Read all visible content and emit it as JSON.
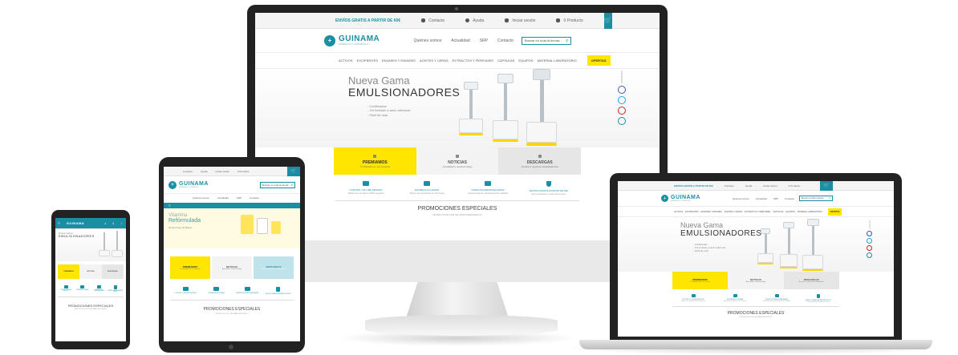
{
  "colors": {
    "teal": "#1a8fa3",
    "yellow": "#ffe600",
    "frame": "#222222"
  },
  "site": {
    "promo": "ENVÍOS GRATIS A PARTIR DE 60€",
    "topbar": [
      "Contacto",
      "Ayuda",
      "Iniciar sesión",
      "0 Producto"
    ],
    "logo_name": "GUINAMA",
    "logo_tag": "FARMACIA Y COSMÉTICA",
    "header_links": [
      "Quiénes somos",
      "Actualidad",
      "SRP",
      "Contacto"
    ],
    "search_placeholder": "Buscar en toda la tienda...",
    "categories": [
      "ACTIVOS",
      "EXCIPIENTES",
      "ENVASES Y ENVASES",
      "ACEITES Y CERAS",
      "EXTRACTOS Y PERFUMES",
      "CAPSULAS",
      "EQUIPOS",
      "MATERIAL LABORATORIO"
    ],
    "oferta": "OFERTAS",
    "hero_line1": "Nueva Gama",
    "hero_line2": "EMULSIONADORES",
    "hero_list": [
      "- Certificadas",
      "- 1% limitado a tanto adicional",
      "- Fácil de usar"
    ],
    "social_label": "SÍGUENOS",
    "tiles": [
      {
        "title": "PREMIAMOS",
        "sub": "Tu fidelidad por tus compras"
      },
      {
        "title": "NOTICIAS",
        "sub": "Actualidad y nuestros blogs"
      },
      {
        "title": "DESCARGAS",
        "sub": "Accede a nuestras actualizaciones"
      }
    ],
    "features": [
      {
        "title": "CONTROL ON-LINE SEGURO",
        "sub": "Todas tus compras 100% seguras"
      },
      {
        "title": "ENTREGA 24 HORAS",
        "sub": "Todos tus productos en 24 horas"
      },
      {
        "title": "ATENCIÓN PERSONALIZADA",
        "sub": "Asesoramiento profesional de calidad"
      },
      {
        "title": "ENVÍOS GRATIS A PARTIR DE 60€",
        "sub": "En península y resto de la zona"
      }
    ],
    "promos_title": "PROMOCIONES ESPECIALES",
    "promos_sub": "PRODUCTOS CON UN GRAN DESCUENTO",
    "tablet_band": "Vitamina Refórmulada",
    "tablet_banner_a": "Vitamina",
    "tablet_banner_b": "Refórmulada",
    "tablet_banner_c": "Nueva línea de Bases",
    "phone_mobile_title": "EMULSIONADORES"
  }
}
